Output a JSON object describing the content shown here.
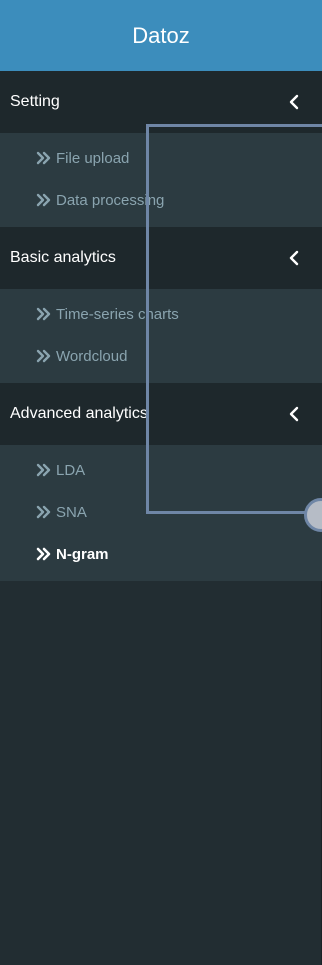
{
  "app": {
    "title": "Datoz"
  },
  "colors": {
    "header_bg": "#3c8dbc",
    "sidebar_bg": "#222d32",
    "section_bg": "#1e282c",
    "submenu_bg": "#2c3b41",
    "submenu_text": "#8aa4af",
    "active_text": "#ffffff",
    "overlay_stroke": "#6f86a6"
  },
  "menu": {
    "sections": [
      {
        "label": "Setting",
        "icon": "chevron-left-icon",
        "items": [
          {
            "label": "File upload",
            "icon": "double-chevron-right-icon",
            "active": false
          },
          {
            "label": "Data processing",
            "icon": "double-chevron-right-icon",
            "active": false
          }
        ]
      },
      {
        "label": "Basic analytics",
        "icon": "chevron-left-icon",
        "items": [
          {
            "label": "Time-series charts",
            "icon": "double-chevron-right-icon",
            "active": false
          },
          {
            "label": "Wordcloud",
            "icon": "double-chevron-right-icon",
            "active": false
          }
        ]
      },
      {
        "label": "Advanced analytics",
        "icon": "chevron-left-icon",
        "items": [
          {
            "label": "LDA",
            "icon": "double-chevron-right-icon",
            "active": false
          },
          {
            "label": "SNA",
            "icon": "double-chevron-right-icon",
            "active": false
          },
          {
            "label": "N-gram",
            "icon": "double-chevron-right-icon",
            "active": true
          }
        ]
      }
    ]
  }
}
